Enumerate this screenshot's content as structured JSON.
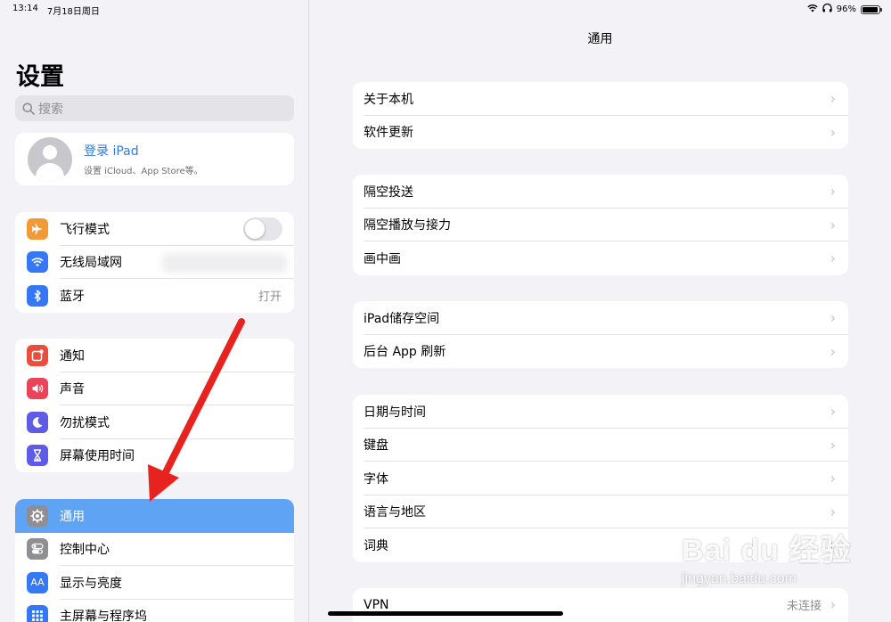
{
  "status_bar": {
    "time": "13:14",
    "date": "7月18日周日",
    "battery": "96%",
    "battery_level": 0.96
  },
  "sidebar": {
    "title": "设置",
    "search_placeholder": "搜索",
    "profile": {
      "title": "登录 iPad",
      "subtitle": "设置 iCloud、App Store等。"
    },
    "group1": [
      {
        "label": "飞行模式",
        "icon": "airplane-icon",
        "color": "#f19a38",
        "toggle": false
      },
      {
        "label": "无线局域网",
        "icon": "wifi-icon",
        "color": "#3478f6"
      },
      {
        "label": "蓝牙",
        "icon": "bluetooth-icon",
        "color": "#3478f6",
        "value": "打开"
      }
    ],
    "group2": [
      {
        "label": "通知",
        "icon": "notifications-icon",
        "color": "#eb4d3d"
      },
      {
        "label": "声音",
        "icon": "sound-icon",
        "color": "#eb445a"
      },
      {
        "label": "勿扰模式",
        "icon": "moon-icon",
        "color": "#5e5ce6"
      },
      {
        "label": "屏幕使用时间",
        "icon": "hourglass-icon",
        "color": "#5e5ce6"
      }
    ],
    "group3": [
      {
        "label": "通用",
        "icon": "gear-icon",
        "color": "#8e8e93",
        "selected": true
      },
      {
        "label": "控制中心",
        "icon": "toggles-icon",
        "color": "#8e8e93"
      },
      {
        "label": "显示与亮度",
        "icon": "display-icon",
        "color": "#3478f6"
      },
      {
        "label": "主屏幕与程序坞",
        "icon": "grid-icon",
        "color": "#3478f6"
      }
    ]
  },
  "detail": {
    "title": "通用",
    "groups": [
      [
        "关于本机",
        "软件更新"
      ],
      [
        "隔空投送",
        "隔空播放与接力",
        "画中画"
      ],
      [
        "iPad储存空间",
        "后台 App 刷新"
      ],
      [
        "日期与时间",
        "键盘",
        "字体",
        "语言与地区",
        "词典"
      ]
    ],
    "vpn": {
      "label": "VPN",
      "value": "未连接"
    }
  },
  "watermark": {
    "line1": "Bai du 经验",
    "line2": "jingyan.baidu.com"
  },
  "annotation": {
    "color": "#e8231f"
  }
}
